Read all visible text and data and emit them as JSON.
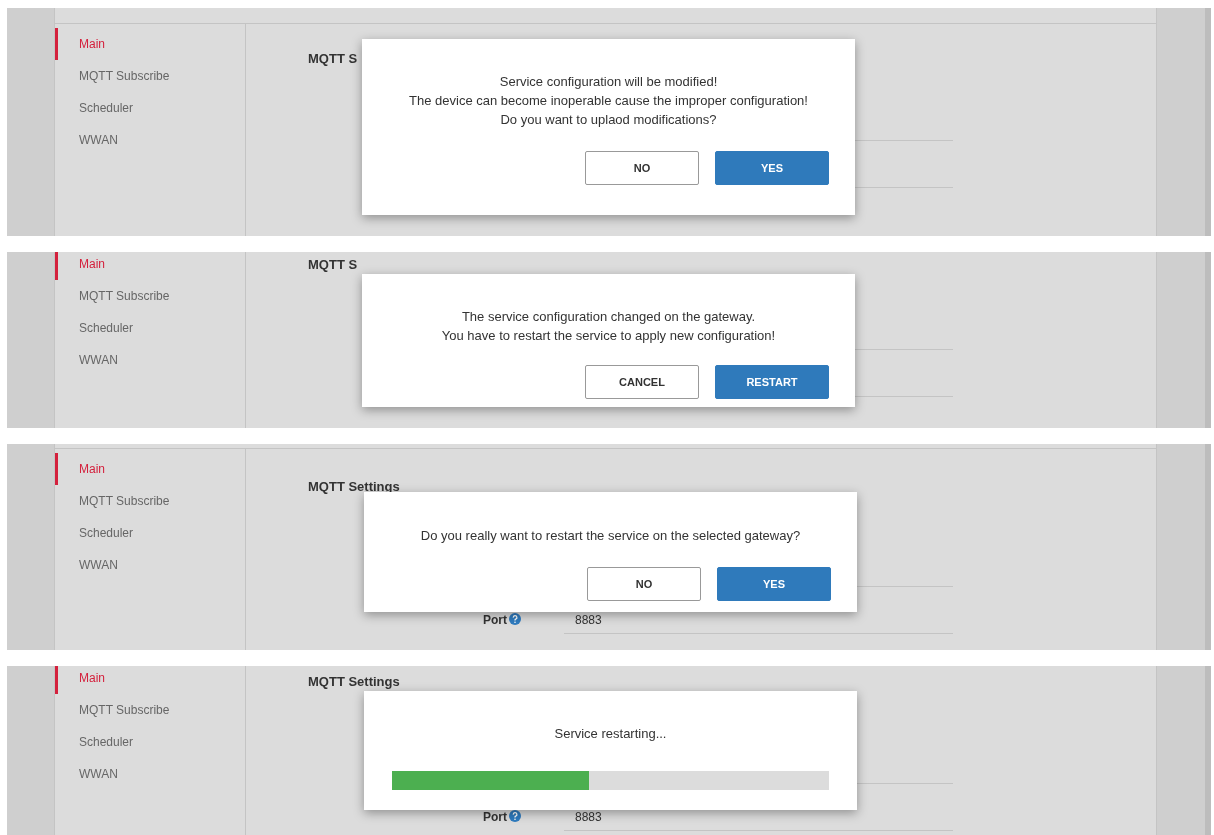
{
  "panels": [
    {
      "sidebar": {
        "items": [
          {
            "label": "Main",
            "selected": true
          },
          {
            "label": "MQTT Subscribe",
            "selected": false
          },
          {
            "label": "Scheduler",
            "selected": false
          },
          {
            "label": "WWAN",
            "selected": false
          }
        ]
      },
      "heading": "MQTT S",
      "dialog": {
        "kind": "confirm",
        "message_lines": [
          "Service configuration will be modified!",
          "The device can become inoperable cause the improper configuration!",
          "Do you want to uplaod modifications?"
        ],
        "buttons": [
          {
            "label": "NO",
            "primary": false
          },
          {
            "label": "YES",
            "primary": true
          }
        ]
      }
    },
    {
      "sidebar": {
        "items": [
          {
            "label": "Main",
            "selected": true
          },
          {
            "label": "MQTT Subscribe",
            "selected": false
          },
          {
            "label": "Scheduler",
            "selected": false
          },
          {
            "label": "WWAN",
            "selected": false
          }
        ]
      },
      "heading": "MQTT S",
      "dialog": {
        "kind": "confirm",
        "message_lines": [
          "The service configuration changed on the gateway.",
          "You have to restart the service to apply new configuration!"
        ],
        "buttons": [
          {
            "label": "CANCEL",
            "primary": false
          },
          {
            "label": "RESTART",
            "primary": true
          }
        ]
      }
    },
    {
      "sidebar": {
        "items": [
          {
            "label": "Main",
            "selected": true
          },
          {
            "label": "MQTT Subscribe",
            "selected": false
          },
          {
            "label": "Scheduler",
            "selected": false
          },
          {
            "label": "WWAN",
            "selected": false
          }
        ]
      },
      "heading": "MQTT Settings",
      "fields": [
        {
          "label": "Port",
          "value": "8883"
        }
      ],
      "dialog": {
        "kind": "confirm",
        "message_lines": [
          "Do you really want to restart the service on the selected gateway?"
        ],
        "buttons": [
          {
            "label": "NO",
            "primary": false
          },
          {
            "label": "YES",
            "primary": true
          }
        ]
      }
    },
    {
      "sidebar": {
        "items": [
          {
            "label": "Main",
            "selected": true
          },
          {
            "label": "MQTT Subscribe",
            "selected": false
          },
          {
            "label": "Scheduler",
            "selected": false
          },
          {
            "label": "WWAN",
            "selected": false
          }
        ]
      },
      "heading": "MQTT Settings",
      "fields": [
        {
          "label": "Port",
          "value": "8883"
        }
      ],
      "dialog": {
        "kind": "progress",
        "message_lines": [
          "Service restarting..."
        ],
        "level": 0.45
      }
    }
  ]
}
